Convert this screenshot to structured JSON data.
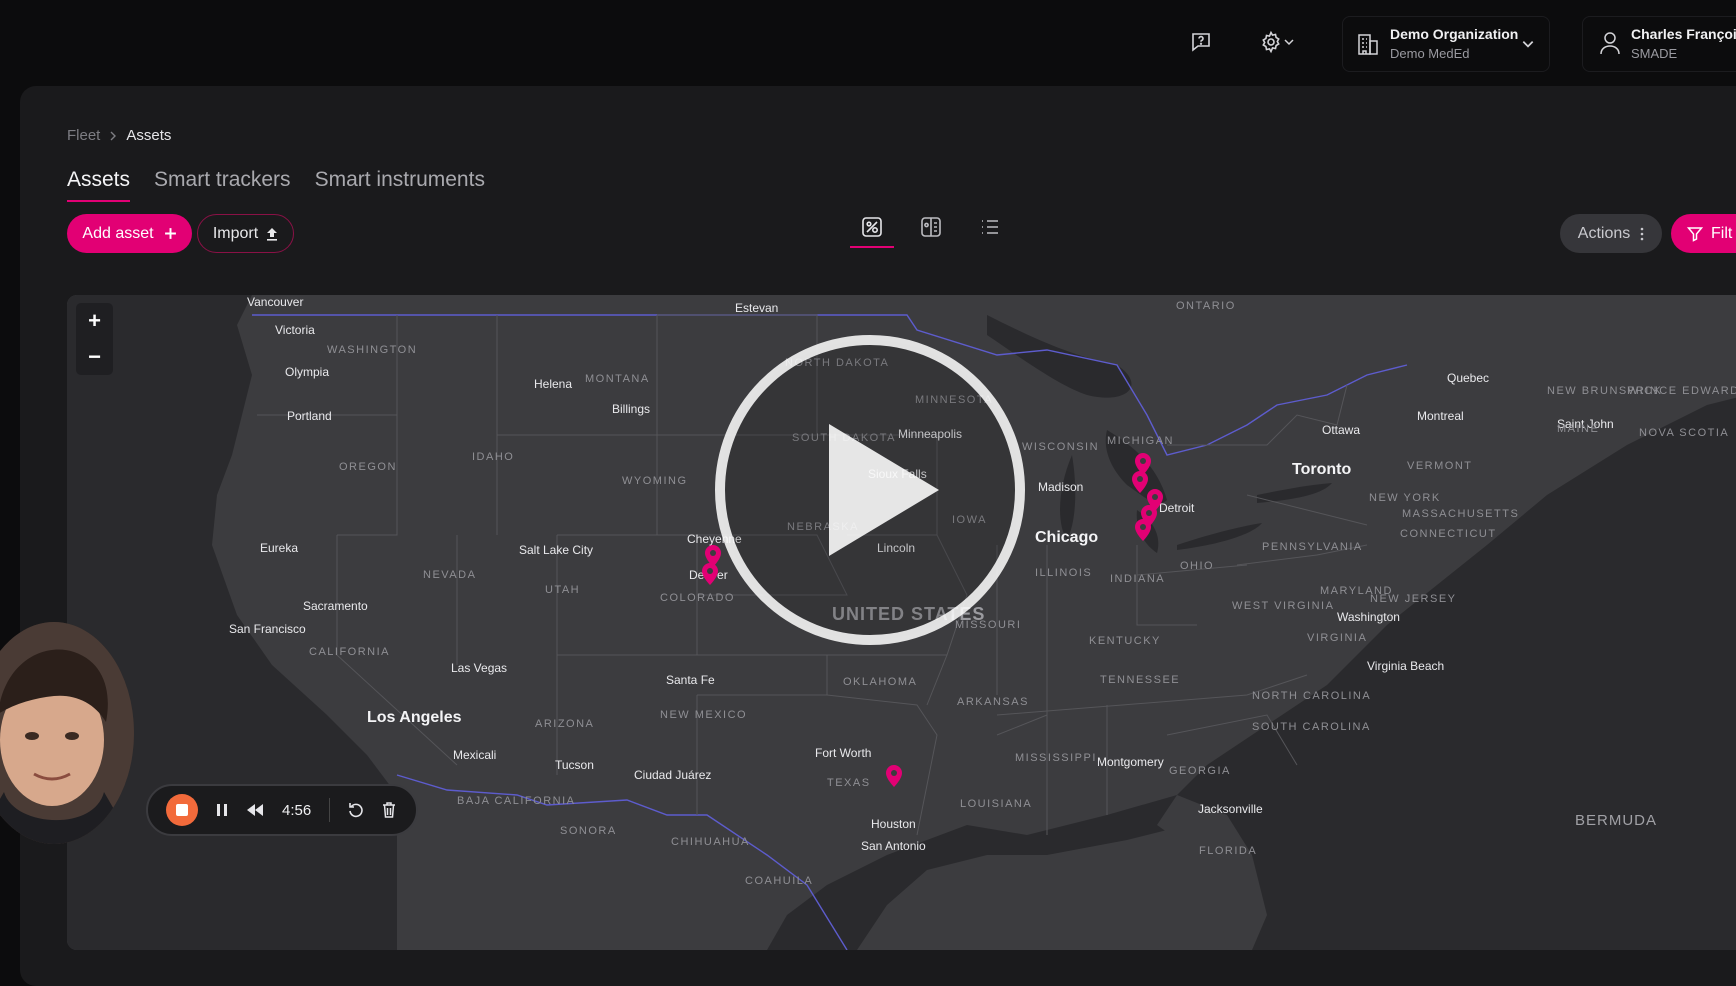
{
  "header": {
    "help_icon": "help-chat-icon",
    "settings_icon": "gear-icon",
    "org_name": "Demo Organization",
    "org_sub": "Demo MedEd",
    "user_name": "Charles François",
    "user_sub": "SMADE"
  },
  "breadcrumb": {
    "root": "Fleet",
    "current": "Assets"
  },
  "tabs": [
    {
      "label": "Assets",
      "active": true
    },
    {
      "label": "Smart trackers",
      "active": false
    },
    {
      "label": "Smart instruments",
      "active": false
    }
  ],
  "toolbar": {
    "add_label": "Add asset",
    "import_label": "Import",
    "actions_label": "Actions",
    "filter_label": "Filt",
    "views": [
      "map-view-icon",
      "split-view-icon",
      "list-view-icon"
    ],
    "accent": "#e20074"
  },
  "map": {
    "cities_major": [
      "Los Angeles",
      "Chicago",
      "Toronto"
    ],
    "cities": [
      "Vancouver",
      "Victoria",
      "Estevan",
      "Olympia",
      "Portland",
      "Helena",
      "Billings",
      "Minneapolis",
      "Sioux Falls",
      "Madison",
      "Detroit",
      "Quebec",
      "Montreal",
      "Ottawa",
      "Saint John",
      "Eureka",
      "Salt Lake City",
      "Cheyenne",
      "Denver",
      "Lincoln",
      "Sacramento",
      "San Francisco",
      "Las Vegas",
      "Santa Fe",
      "Washington",
      "Virginia Beach",
      "Fort Worth",
      "Mexicali",
      "Tucson",
      "Ciudad Juárez",
      "Montgomery",
      "Jacksonville",
      "Houston",
      "San Antonio"
    ],
    "states": [
      "WASHINGTON",
      "MONTANA",
      "NORTH DAKOTA",
      "MINNESOTA",
      "OREGON",
      "IDAHO",
      "WYOMING",
      "SOUTH DAKOTA",
      "WISCONSIN",
      "MICHIGAN",
      "NEBRASKA",
      "IOWA",
      "ILLINOIS",
      "INDIANA",
      "OHIO",
      "PENNSYLVANIA",
      "NEVADA",
      "UTAH",
      "COLORADO",
      "CALIFORNIA",
      "MISSOURI",
      "KENTUCKY",
      "WEST VIRGINIA",
      "VIRGINIA",
      "MARYLAND",
      "NEW JERSEY",
      "CONNECTICUT",
      "MASSACHUSETTS",
      "NEW YORK",
      "VERMONT",
      "MAINE",
      "ARIZONA",
      "NEW MEXICO",
      "OKLAHOMA",
      "ARKANSAS",
      "TENNESSEE",
      "NORTH CAROLINA",
      "SOUTH CAROLINA",
      "MISSISSIPPI",
      "GEORGIA",
      "TEXAS",
      "LOUISIANA",
      "FLORIDA",
      "ONTARIO",
      "NEW BRUNSWICK",
      "PRINCE EDWARD ISLAND",
      "NOVA SCOTIA",
      "BAJA CALIFORNIA",
      "SONORA",
      "CHIHUAHUA",
      "COAHUILA"
    ],
    "country": "UNITED STATES",
    "sea": "BERMUDA",
    "zoom_in": "+",
    "zoom_out": "−"
  },
  "recorder": {
    "time": "4:56"
  }
}
